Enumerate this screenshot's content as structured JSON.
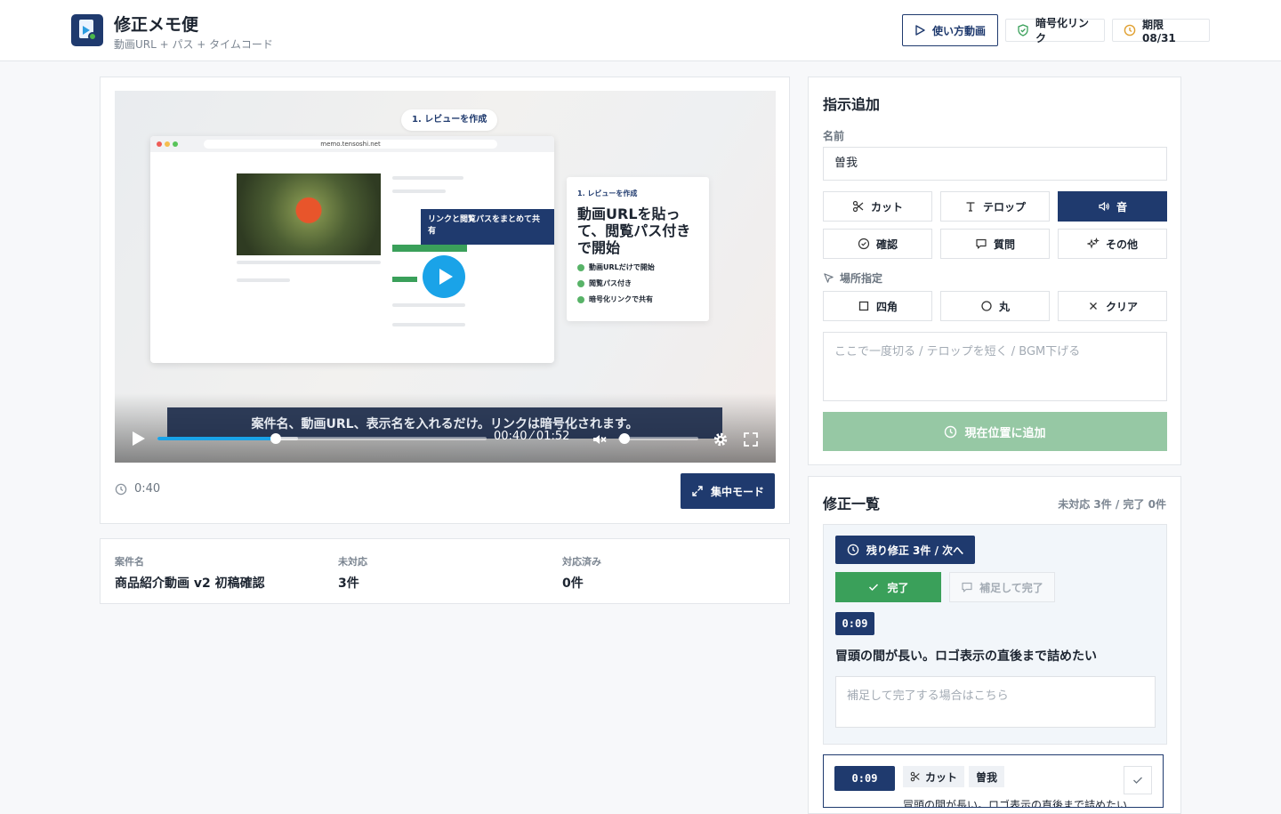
{
  "header": {
    "title": "修正メモ便",
    "subtitle": "動画URL + パス + タイムコード",
    "how_to_label": "使い方動画",
    "encrypted_label": "暗号化リンク",
    "expiry_label": "期限 08/31"
  },
  "video": {
    "step_pill": "1. レビューを作成",
    "mock_url": "memo.tensoshi.net",
    "mock_tooltip": "リンクと閲覧パスをまとめて共有",
    "card_step": "1. レビューを作成",
    "card_headline": "動画URLを貼って、閲覧パス付きで開始",
    "card_bullets": [
      "動画URLだけで開始",
      "閲覧パス付き",
      "暗号化リンクで共有"
    ],
    "caption": "案件名、動画URL、表示名を入れるだけ。リンクは暗号化されます。",
    "time_display": "00:40 ⁄ 01:52",
    "progress": 0.36,
    "volume": 0.0
  },
  "player": {
    "current_time": "0:40",
    "focus_mode_label": "集中モード"
  },
  "info": {
    "project_key": "案件名",
    "project_value": "商品紹介動画 v2 初稿確認",
    "open_key": "未対応",
    "open_value": "3件",
    "done_key": "対応済み",
    "done_value": "0件"
  },
  "add_form": {
    "title": "指示追加",
    "name_label": "名前",
    "name_value": "曽我",
    "types": [
      "カット",
      "テロップ",
      "音",
      "確認",
      "質問",
      "その他"
    ],
    "selected_type": "音",
    "location_label": "場所指定",
    "shapes": [
      "四角",
      "丸",
      "クリア"
    ],
    "note_placeholder": "ここで一度切る / テロップを短く / BGM下げる",
    "add_button": "現在位置に追加"
  },
  "list": {
    "title": "修正一覧",
    "counts": "未対応 3件 / 完了 0件",
    "next_button": "残り修正 3件 / 次へ",
    "done_button": "完了",
    "supp_button": "補足して完了",
    "active_timecode": "0:09",
    "active_text": "冒頭の間が長い。ロゴ表示の直後まで詰めたい",
    "supp_placeholder": "補足して完了する場合はこちら",
    "item2_timecode": "0:09",
    "item2_type": "カット",
    "item2_author": "曽我",
    "item2_text": "冒頭の間が長い。ロゴ表示の直後まで詰めたい"
  },
  "colors": {
    "navy": "#1f3a6e",
    "green": "#3aa05a",
    "blue_accent": "#1aa3e8"
  }
}
